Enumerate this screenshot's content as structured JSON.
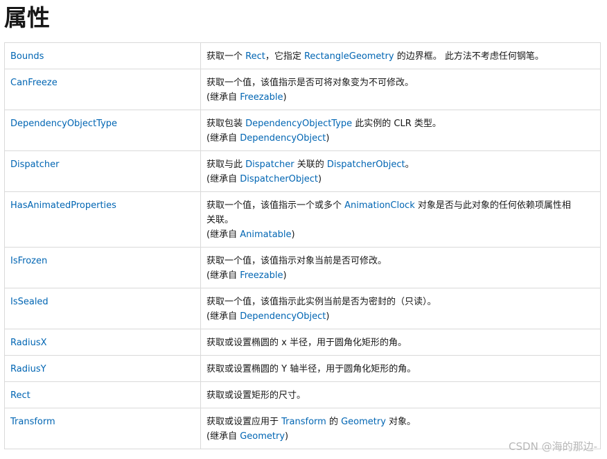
{
  "page_title": "属性",
  "link_color": "#0065b3",
  "rows": [
    {
      "name": "Bounds",
      "lines": [
        [
          {
            "t": "获取一个 "
          },
          {
            "t": "Rect",
            "link": true
          },
          {
            "t": "，它指定 "
          },
          {
            "t": "RectangleGeometry",
            "link": true
          },
          {
            "t": " 的边界框。 此方法不考虑任何钢笔。"
          }
        ]
      ]
    },
    {
      "name": "CanFreeze",
      "lines": [
        [
          {
            "t": "获取一个值，该值指示是否可将对象变为不可修改。"
          }
        ],
        [
          {
            "t": "(继承自 "
          },
          {
            "t": "Freezable",
            "link": true
          },
          {
            "t": ")"
          }
        ]
      ]
    },
    {
      "name": "DependencyObjectType",
      "lines": [
        [
          {
            "t": "获取包装 "
          },
          {
            "t": "DependencyObjectType",
            "link": true
          },
          {
            "t": " 此实例的 CLR 类型。"
          }
        ],
        [
          {
            "t": "(继承自 "
          },
          {
            "t": "DependencyObject",
            "link": true
          },
          {
            "t": ")"
          }
        ]
      ]
    },
    {
      "name": "Dispatcher",
      "lines": [
        [
          {
            "t": "获取与此 "
          },
          {
            "t": "Dispatcher",
            "link": true
          },
          {
            "t": " 关联的 "
          },
          {
            "t": "DispatcherObject",
            "link": true
          },
          {
            "t": "。"
          }
        ],
        [
          {
            "t": "(继承自 "
          },
          {
            "t": "DispatcherObject",
            "link": true
          },
          {
            "t": ")"
          }
        ]
      ]
    },
    {
      "name": "HasAnimatedProperties",
      "lines": [
        [
          {
            "t": "获取一个值，该值指示一个或多个 "
          },
          {
            "t": "AnimationClock",
            "link": true
          },
          {
            "t": " 对象是否与此对象的任何依赖项属性相"
          }
        ],
        [
          {
            "t": "关联。"
          }
        ],
        [
          {
            "t": "(继承自 "
          },
          {
            "t": "Animatable",
            "link": true
          },
          {
            "t": ")"
          }
        ]
      ]
    },
    {
      "name": "IsFrozen",
      "lines": [
        [
          {
            "t": "获取一个值，该值指示对象当前是否可修改。"
          }
        ],
        [
          {
            "t": "(继承自 "
          },
          {
            "t": "Freezable",
            "link": true
          },
          {
            "t": ")"
          }
        ]
      ]
    },
    {
      "name": "IsSealed",
      "lines": [
        [
          {
            "t": "获取一个值，该值指示此实例当前是否为密封的（只读）。"
          }
        ],
        [
          {
            "t": "(继承自 "
          },
          {
            "t": "DependencyObject",
            "link": true
          },
          {
            "t": ")"
          }
        ]
      ]
    },
    {
      "name": "RadiusX",
      "lines": [
        [
          {
            "t": "获取或设置椭圆的 x 半径，用于圆角化矩形的角。"
          }
        ]
      ]
    },
    {
      "name": "RadiusY",
      "lines": [
        [
          {
            "t": "获取或设置椭圆的 Y 轴半径，用于圆角化矩形的角。"
          }
        ]
      ]
    },
    {
      "name": "Rect",
      "lines": [
        [
          {
            "t": "获取或设置矩形的尺寸。"
          }
        ]
      ]
    },
    {
      "name": "Transform",
      "lines": [
        [
          {
            "t": "获取或设置应用于 "
          },
          {
            "t": "Transform",
            "link": true
          },
          {
            "t": " 的 "
          },
          {
            "t": "Geometry",
            "link": true
          },
          {
            "t": " 对象。"
          }
        ],
        [
          {
            "t": "(继承自 "
          },
          {
            "t": "Geometry",
            "link": true
          },
          {
            "t": ")"
          }
        ]
      ]
    }
  ],
  "watermark": "CSDN @海的那边-"
}
